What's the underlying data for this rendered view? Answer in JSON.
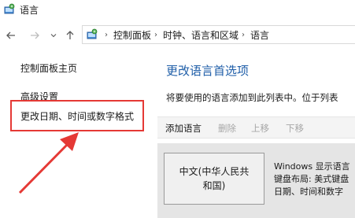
{
  "window": {
    "title": "语言",
    "icon": "control-panel-icon"
  },
  "nav": {
    "back_icon": "back-arrow-icon",
    "forward_icon": "forward-arrow-icon",
    "recent_icon": "chevron-down-icon",
    "up_icon": "up-arrow-icon"
  },
  "address": {
    "icon": "control-panel-icon",
    "crumbs": [
      "控制面板",
      "时钟、语言和区域",
      "语言"
    ]
  },
  "sidebar": {
    "items": [
      {
        "label": "控制面板主页"
      },
      {
        "label": "高级设置"
      },
      {
        "label": "更改日期、时间或数字格式"
      }
    ],
    "highlight_color": "#e53935"
  },
  "main": {
    "heading": "更改语言首选项",
    "description": "将要使用的语言添加到此列表中。位于列表",
    "toolbar": {
      "add": "添加语言",
      "remove": "删除",
      "move_up": "上移",
      "move_down": "下移"
    },
    "language": {
      "name_line1": "中文(中华人民共",
      "name_line2": "和国)",
      "detail_line1": "Windows 显示语言",
      "detail_line2": "键盘布局: 美式键盘",
      "detail_line3": "日期、时间和数字"
    }
  },
  "colors": {
    "heading": "#1f5ea8",
    "highlight": "#e53935"
  }
}
